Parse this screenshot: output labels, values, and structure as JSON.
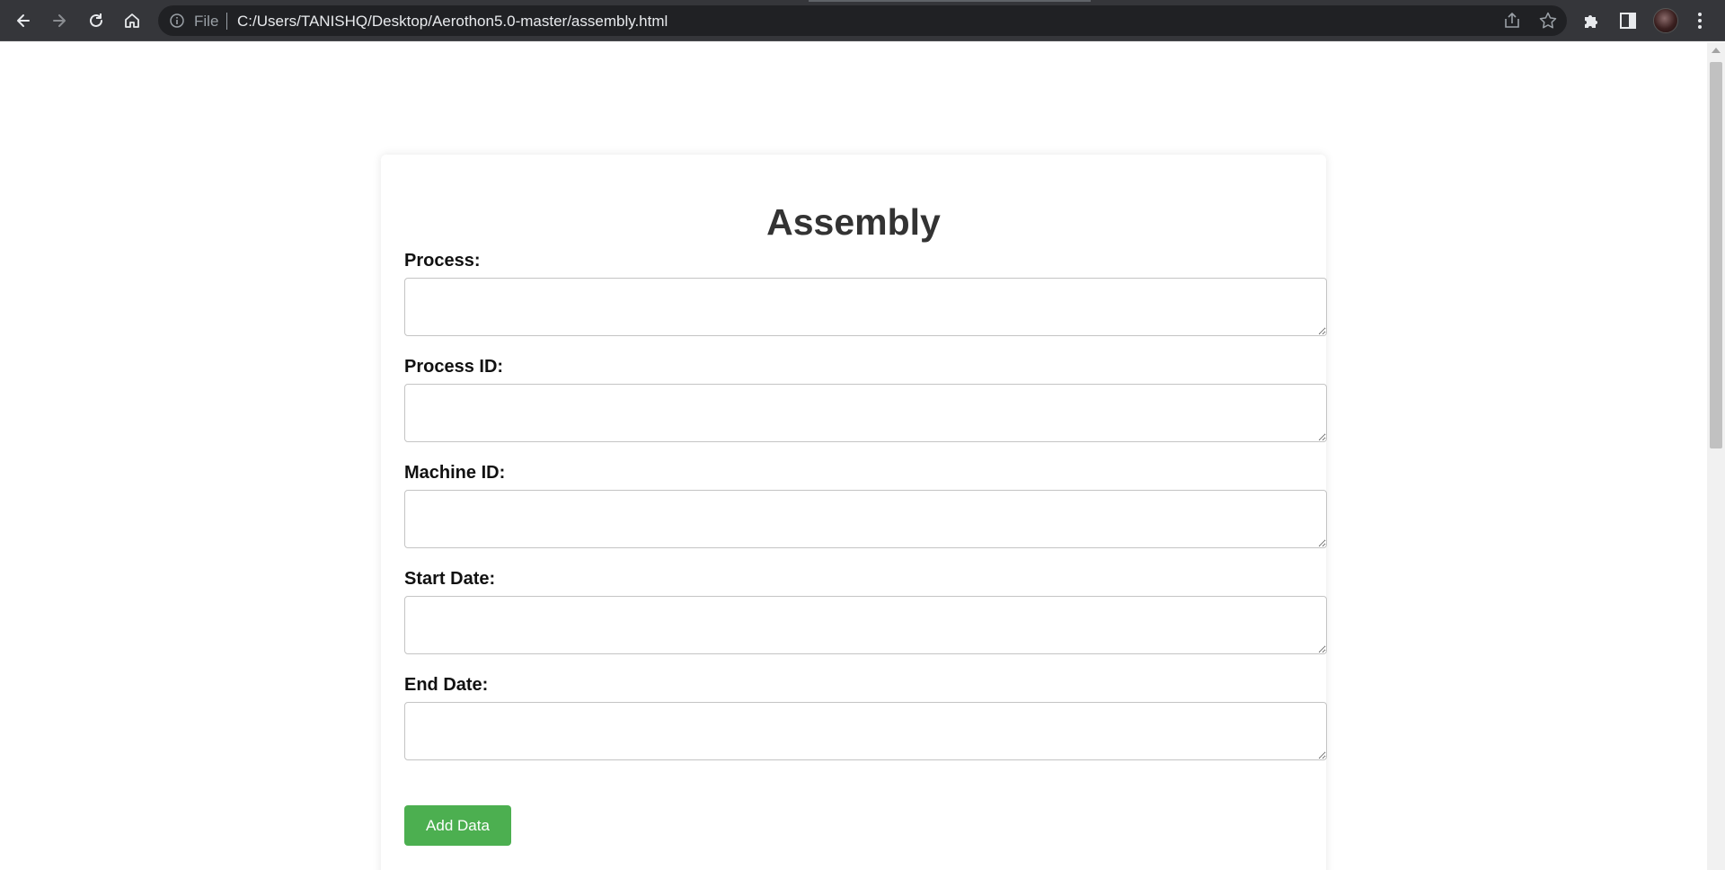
{
  "browser": {
    "scheme_label": "File",
    "url": "C:/Users/TANISHQ/Desktop/Aerothon5.0-master/assembly.html",
    "icons": {
      "back": "back-arrow-icon",
      "forward": "forward-arrow-icon",
      "reload": "reload-icon",
      "home": "home-icon",
      "info": "info-icon",
      "share": "share-icon",
      "bookmark": "star-icon",
      "extensions": "puzzle-icon",
      "side_panel": "side-panel-icon",
      "profile": "avatar",
      "menu": "kebab-menu-icon"
    }
  },
  "page": {
    "title": "Assembly",
    "fields": [
      {
        "label": "Process:",
        "value": ""
      },
      {
        "label": "Process ID:",
        "value": ""
      },
      {
        "label": "Machine ID:",
        "value": ""
      },
      {
        "label": "Start Date:",
        "value": ""
      },
      {
        "label": "End Date:",
        "value": ""
      }
    ],
    "submit_label": "Add Data"
  },
  "colors": {
    "toolbar": "#35363a",
    "omnibox": "#202124",
    "button": "#4caf50",
    "title": "#333333"
  }
}
